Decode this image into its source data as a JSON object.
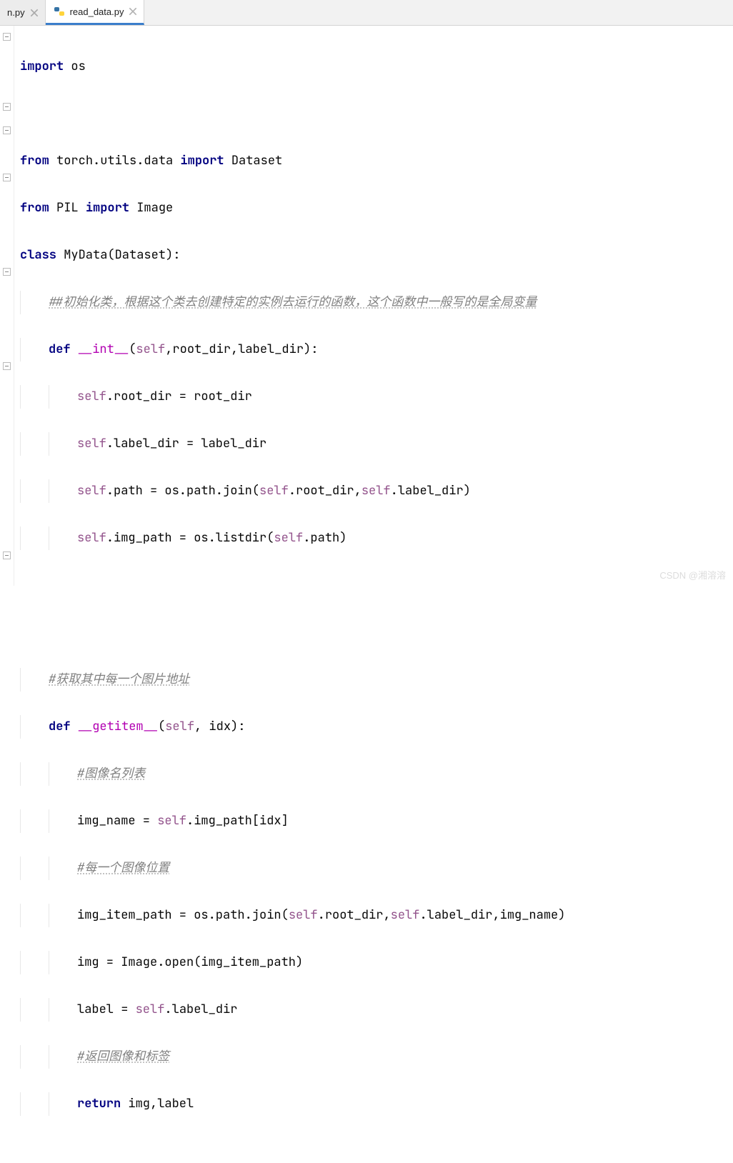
{
  "tabs": [
    {
      "label": "n.py",
      "active": false
    },
    {
      "label": "read_data.py",
      "active": true
    }
  ],
  "code": {
    "l1": {
      "kw1": "import",
      "mod": "os"
    },
    "l3": {
      "kw1": "from",
      "mod": "torch.utils.data",
      "kw2": "import",
      "name": "Dataset"
    },
    "l4": {
      "kw1": "from",
      "mod": "PIL",
      "kw2": "import",
      "name": "Image"
    },
    "l5": {
      "kw1": "class",
      "name": "MyData(Dataset):"
    },
    "l6": {
      "cmt": "##初始化类，根据这个类去创建特定的实例去运行的函数，这个函数中一般写的是全局变量"
    },
    "l7": {
      "kw": "def",
      "fn": "__int__",
      "sig_open": "(",
      "self": "self",
      "sig_rest": ",root_dir,label_dir):"
    },
    "l8": {
      "self": "self",
      "rest": ".root_dir = root_dir"
    },
    "l9": {
      "self": "self",
      "rest": ".label_dir = label_dir"
    },
    "l10": {
      "self": "self",
      "mid1": ".path = os.path.join(",
      "self2": "self",
      "mid2": ".root_dir,",
      "self3": "self",
      "rest": ".label_dir)"
    },
    "l11": {
      "self": "self",
      "mid1": ".img_path = os.listdir(",
      "self2": "self",
      "rest": ".path)"
    },
    "l14": {
      "cmt": "#获取其中每一个图片地址"
    },
    "l15": {
      "kw": "def",
      "fn": "__getitem__",
      "sig_open": "(",
      "self": "self",
      "sig_rest": ", idx):"
    },
    "l16": {
      "cmt": "#图像名列表"
    },
    "l17": {
      "pre": "img_name = ",
      "self": "self",
      "rest": ".img_path[idx]"
    },
    "l18": {
      "cmt": "#每一个图像位置"
    },
    "l19": {
      "pre": "img_item_path = os.path.join(",
      "self": "self",
      "mid1": ".root_dir,",
      "self2": "self",
      "rest": ".label_dir,img_name)"
    },
    "l20": {
      "rest": "img = Image.open(img_item_path)"
    },
    "l21": {
      "pre": "label = ",
      "self": "self",
      "rest": ".label_dir"
    },
    "l22": {
      "cmt": "#返回图像和标签"
    },
    "l23": {
      "kw": "return",
      "rest": " img,label"
    }
  },
  "watermark": "CSDN @湘溶溶"
}
